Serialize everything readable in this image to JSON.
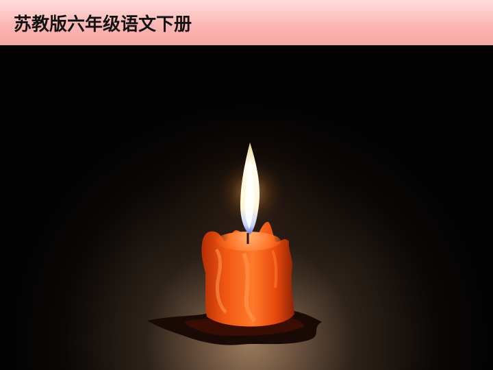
{
  "header": {
    "title": "苏教版六年级语文下册"
  },
  "photo": {
    "subject": "candle-photo"
  },
  "colors": {
    "header_top": "#ffdedc",
    "header_bottom": "#f7a7a4",
    "background": "#000000",
    "wax": "#ff5a14",
    "flame": "#fffbe8"
  }
}
